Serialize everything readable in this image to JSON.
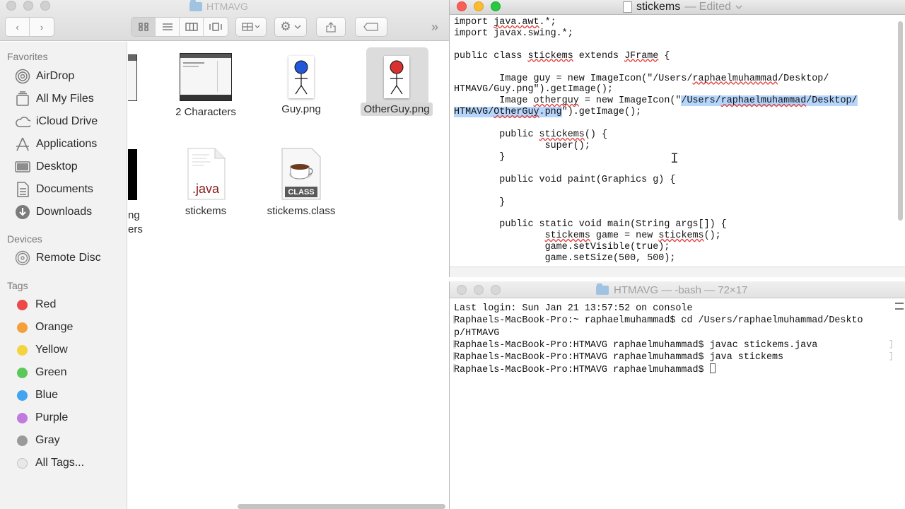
{
  "finder": {
    "title": "HTMAVG",
    "sidebar": {
      "favorites_heading": "Favorites",
      "favorites": [
        {
          "label": "AirDrop",
          "icon": "airdrop-icon"
        },
        {
          "label": "All My Files",
          "icon": "all-files-icon"
        },
        {
          "label": "iCloud Drive",
          "icon": "cloud-icon"
        },
        {
          "label": "Applications",
          "icon": "applications-icon"
        },
        {
          "label": "Desktop",
          "icon": "desktop-icon"
        },
        {
          "label": "Documents",
          "icon": "documents-icon"
        },
        {
          "label": "Downloads",
          "icon": "downloads-icon"
        }
      ],
      "devices_heading": "Devices",
      "devices": [
        {
          "label": "Remote Disc",
          "icon": "disc-icon"
        }
      ],
      "tags_heading": "Tags",
      "tags": [
        {
          "label": "Red",
          "color": "#ec4a4a"
        },
        {
          "label": "Orange",
          "color": "#f4a03a"
        },
        {
          "label": "Yellow",
          "color": "#f5d33f"
        },
        {
          "label": "Green",
          "color": "#5cc85a"
        },
        {
          "label": "Blue",
          "color": "#42a3ee"
        },
        {
          "label": "Purple",
          "color": "#c07ae0"
        },
        {
          "label": "Gray",
          "color": "#9a9a9a"
        },
        {
          "label": "All Tags...",
          "color": "#e8e8e8"
        }
      ]
    },
    "files": [
      {
        "name": "2 Characters"
      },
      {
        "name": "Guy.png"
      },
      {
        "name": "OtherGuy.png"
      },
      {
        "name": "stickems"
      },
      {
        "name": "stickems.class"
      }
    ],
    "partial_label_1": "ng",
    "partial_label_2": "ers",
    "java_badge": ".java",
    "class_badge": "CLASS"
  },
  "editor": {
    "doc_name": "stickems",
    "doc_status": "— Edited",
    "code": {
      "l1a": "import ",
      "l1b": "java.awt",
      "l1c": ".*;",
      "l2": "import javax.swing.*;",
      "l4a": "public class ",
      "l4b": "stickems",
      "l4c": " extends ",
      "l4d": "JFrame",
      "l4e": " {",
      "l6": "        Image guy = new ImageIcon(\"/Users/",
      "l6b": "raphaelmuhammad",
      "l6c": "/Desktop/",
      "l7": "HTMAVG/Guy.png\").getImage();",
      "l8a": "        Image ",
      "l8b": "otherguy",
      "l8c": " = new ImageIcon(\"",
      "l8d": "/Users/",
      "l8e": "raphaelmuhammad",
      "l8f": "/Desktop/",
      "l9a": "HTMAVG/",
      "l9b": "OtherGuy",
      "l9c": ".png",
      "l9d": "\").getImage();",
      "l11a": "        public ",
      "l11b": "stickems",
      "l11c": "() {",
      "l12": "                super();",
      "l13": "        }",
      "l15": "        public void paint(Graphics g) {",
      "l17": "        }",
      "l19": "        public static void main(String args[]) {",
      "l20a": "                ",
      "l20b": "stickems",
      "l20c": " game = new ",
      "l20d": "stickems",
      "l20e": "();",
      "l21": "                game.setVisible(true);",
      "l22": "                game.setSize(500, 500);"
    }
  },
  "terminal": {
    "title": "HTMAVG — -bash — 72×17",
    "lines": [
      "Last login: Sun Jan 21 13:57:52 on console",
      "Raphaels-MacBook-Pro:~ raphaelmuhammad$ cd /Users/raphaelmuhammad/Deskto",
      "p/HTMAVG",
      "Raphaels-MacBook-Pro:HTMAVG raphaelmuhammad$ javac stickems.java",
      "Raphaels-MacBook-Pro:HTMAVG raphaelmuhammad$ java stickems",
      "Raphaels-MacBook-Pro:HTMAVG raphaelmuhammad$ "
    ]
  }
}
